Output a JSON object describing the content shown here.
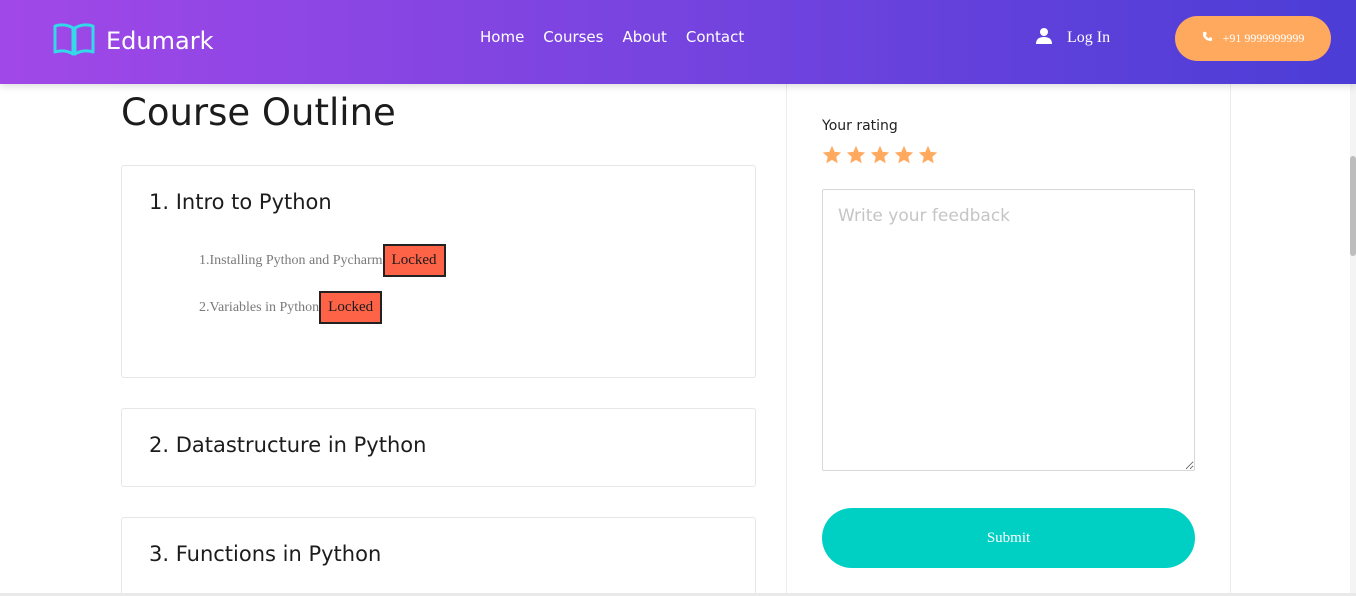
{
  "header": {
    "brand": "Edumark",
    "nav": [
      "Home",
      "Courses",
      "About",
      "Contact"
    ],
    "login": "Log In",
    "phone": "+91 9999999999",
    "colors": {
      "gradient_start": "#a148e8",
      "gradient_end": "#4b3dd6",
      "phone_button": "#ffa95e"
    }
  },
  "main": {
    "title": "Course Outline",
    "modules": [
      {
        "title": "1. Intro to Python",
        "lessons": [
          {
            "name": "1.Installing Python and Pycharm",
            "status": "Locked"
          },
          {
            "name": "2.Variables in Python",
            "status": "Locked"
          }
        ]
      },
      {
        "title": "2. Datastructure in Python"
      },
      {
        "title": "3. Functions in Python"
      }
    ]
  },
  "sidebar": {
    "rating_label": "Your rating",
    "stars": 5,
    "feedback_placeholder": "Write your feedback",
    "submit": "Submit",
    "colors": {
      "star": "#ffa95e",
      "submit": "#00d0c4"
    }
  },
  "icons": [
    "book-icon",
    "user-icon",
    "phone-icon",
    "star-icon"
  ]
}
